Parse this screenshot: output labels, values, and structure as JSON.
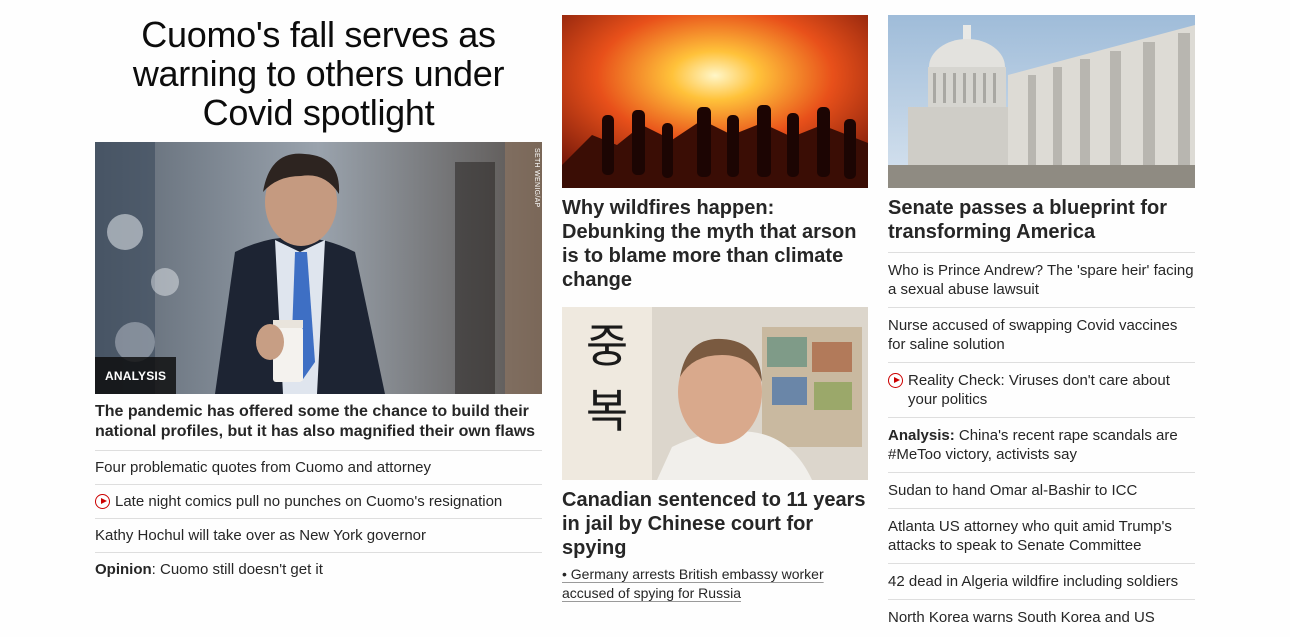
{
  "lead": {
    "headline": "Cuomo's fall serves as warning to others under Covid spotlight",
    "image_credit": "SETH WENIG/AP",
    "badge": "ANALYSIS",
    "subheadline": "The pandemic has offered some the chance to build their national profiles, but it has also magnified their own flaws",
    "links": [
      {
        "prefix": "",
        "text": "Four problematic quotes from Cuomo and attorney",
        "video": false
      },
      {
        "prefix": "",
        "text": "Late night comics pull no punches on Cuomo's resignation",
        "video": true
      },
      {
        "prefix": "",
        "text": "Kathy Hochul will take over as New York governor",
        "video": false
      },
      {
        "prefix": "Opinion",
        "text": ": Cuomo still doesn't get it",
        "video": false
      }
    ]
  },
  "middle": {
    "story1": {
      "headline": "Why wildfires happen: Debunking the myth that arson is to blame more than climate change"
    },
    "story2": {
      "headline": "Canadian sentenced to 11 years in jail by Chinese court for spying",
      "related": "• Germany arrests British embassy worker accused of spying for Russia"
    }
  },
  "right": {
    "headline": "Senate passes a blueprint for transforming America",
    "links": [
      {
        "prefix": "",
        "text": "Who is Prince Andrew? The 'spare heir' facing a sexual abuse lawsuit",
        "video": false
      },
      {
        "prefix": "",
        "text": "Nurse accused of swapping Covid vaccines for saline solution",
        "video": false
      },
      {
        "prefix": "",
        "text": "Reality Check: Viruses don't care about your politics",
        "video": true
      },
      {
        "prefix": "Analysis:",
        "text": " China's recent rape scandals are #MeToo victory, activists say",
        "video": false
      },
      {
        "prefix": "",
        "text": "Sudan to hand Omar al-Bashir to ICC",
        "video": false
      },
      {
        "prefix": "",
        "text": "Atlanta US attorney who quit amid Trump's attacks to speak to Senate Committee",
        "video": false
      },
      {
        "prefix": "",
        "text": "42 dead in Algeria wildfire including soldiers",
        "video": false
      },
      {
        "prefix": "",
        "text": "North Korea warns South Korea and US",
        "video": false
      }
    ]
  },
  "colors": {
    "text": "#262626",
    "divider": "#dedede",
    "video_icon": "#cc0000",
    "badge_bg": "#0c0c0c"
  }
}
